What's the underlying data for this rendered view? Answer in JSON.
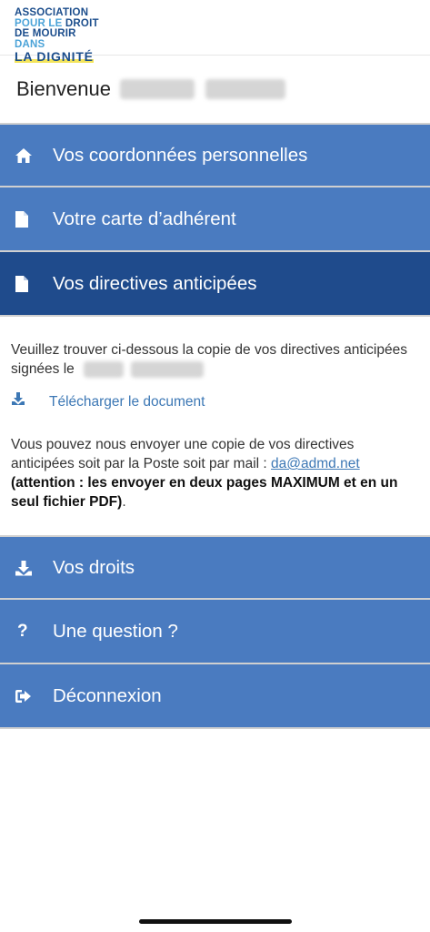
{
  "logo": {
    "line1": "ASSOCIATION",
    "line2a": "POUR LE ",
    "line2b": "DROIT",
    "line3a": "DE MOURIR ",
    "line3b": "DANS",
    "line4": "LA DIGNITÉ"
  },
  "welcome": {
    "label": "Bienvenue"
  },
  "menu": {
    "coordonnees": "Vos coordonnées personnelles",
    "carte": "Votre carte d’adhérent",
    "directives": "Vos directives anticipées",
    "droits": "Vos droits",
    "question": "Une question ?",
    "deconnexion": "Déconnexion"
  },
  "content": {
    "intro": "Veuillez trouver ci-dessous la copie de vos directives anticipées signées le",
    "download": "Télécharger le document",
    "send_text": "Vous pouvez nous envoyer une copie de vos directives anticipées soit par la Poste soit par mail : ",
    "email": "da@admd.net",
    "warning": "(attention : les envoyer en deux pages MAXIMUM et en un seul fichier PDF)",
    "warning_end": "."
  },
  "icons": {
    "coordonnees": "home-icon",
    "carte": "document-icon",
    "directives": "document-icon",
    "download": "download-icon",
    "droits": "download-icon",
    "question": "question-icon",
    "deconnexion": "sign-out-icon"
  },
  "colors": {
    "menu": "#4a7bc0",
    "menu_active": "#1f4b8c",
    "link": "#3d78b5"
  }
}
